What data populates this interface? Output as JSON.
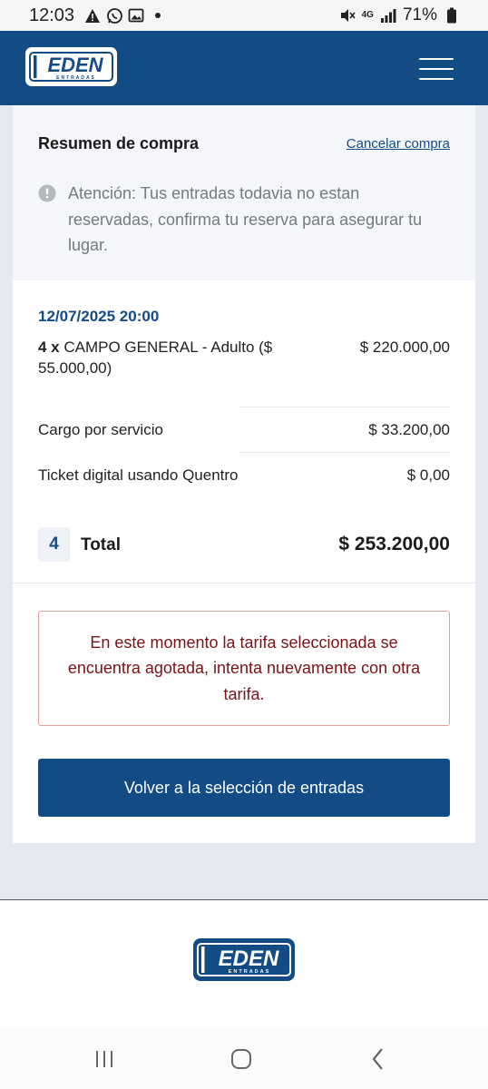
{
  "status_bar": {
    "time": "12:03",
    "network": "4G",
    "battery": "71%"
  },
  "header": {
    "logo_text": "EDEN",
    "logo_subtext": "ENTRADAS"
  },
  "summary": {
    "title": "Resumen de compra",
    "cancel_label": "Cancelar compra",
    "notice": "Atención: Tus entradas todavia no estan reservadas, confirma tu reserva para asegurar tu lugar."
  },
  "order": {
    "event_datetime": "12/07/2025 20:00",
    "ticket_qty": "4 x",
    "ticket_name": "CAMPO GENERAL - Adulto ($ 55.000,00)",
    "ticket_price": "$ 220.000,00",
    "fees": [
      {
        "label": "Cargo por servicio",
        "value": "$ 33.200,00"
      },
      {
        "label": "Ticket digital usando Quentro",
        "value": "$ 0,00"
      }
    ],
    "total_qty": "4",
    "total_label": "Total",
    "total_value": "$ 253.200,00"
  },
  "error_message": "En este momento la tarifa seleccionada se encuentra agotada, intenta nuevamente con otra tarifa.",
  "back_button_label": "Volver a la selección de entradas",
  "footer": {
    "logo_text": "EDEN",
    "logo_subtext": "ENTRADAS"
  },
  "icons": {
    "notice": "info-circle-icon",
    "menu": "hamburger-menu-icon",
    "nav_recents": "recents-icon",
    "nav_home": "home-icon",
    "nav_back": "back-icon"
  },
  "colors": {
    "brand": "#134b85",
    "error_text": "#7a1218",
    "error_border": "#e2a0a3"
  }
}
